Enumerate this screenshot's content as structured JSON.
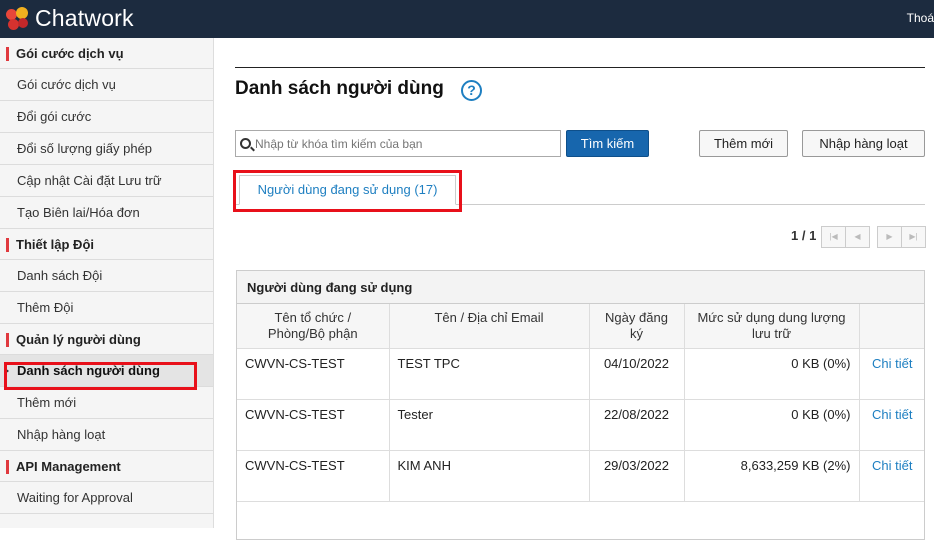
{
  "header": {
    "app_name": "Chatwork",
    "logout_label": "Thoá"
  },
  "sidebar": {
    "sections": [
      {
        "title": "Gói cước dịch vụ",
        "items": [
          "Gói cước dịch vụ",
          "Đổi gói cước",
          "Đổi số lượng giấy phép",
          "Cập nhật Cài đặt Lưu trữ",
          "Tạo Biên lai/Hóa đơn"
        ]
      },
      {
        "title": "Thiết lập Đội",
        "items": [
          "Danh sách Đội",
          "Thêm Đội"
        ]
      },
      {
        "title": "Quản lý người dùng",
        "items": [
          "Danh sách người dùng",
          "Thêm mới",
          "Nhập hàng loạt"
        ]
      },
      {
        "title": "API Management",
        "items": [
          "Waiting for Approval"
        ]
      }
    ],
    "active_item": "Danh sách người dùng"
  },
  "main": {
    "page_title": "Danh sách người dùng",
    "help_icon": "question-circle-icon",
    "search": {
      "placeholder": "Nhập từ khóa tìm kiếm của bạn",
      "value": "",
      "button": "Tìm kiếm"
    },
    "actions": {
      "add_new": "Thêm mới",
      "bulk_import": "Nhập hàng loạt"
    },
    "tab": "Người dùng đang sử dụng (17)",
    "pager": {
      "text": "1 / 1"
    },
    "table": {
      "caption": "Người dùng đang sử dụng",
      "columns": [
        "Tên tổ chức / Phòng/Bộ phận",
        "Tên / Địa chỉ Email",
        "Ngày đăng ký",
        "Mức sử dụng dung lượng lưu trữ",
        ""
      ],
      "rows": [
        {
          "org": "CWVN-CS-TEST",
          "name": "TEST TPC",
          "email": "",
          "date": "04/10/2022",
          "usage": "0 KB (0%)",
          "detail": "Chi tiết"
        },
        {
          "org": "CWVN-CS-TEST",
          "name": "Tester",
          "email": "",
          "date": "22/08/2022",
          "usage": "0 KB (0%)",
          "detail": "Chi tiết"
        },
        {
          "org": "CWVN-CS-TEST",
          "name": "KIM ANH",
          "email": "",
          "date": "29/03/2022",
          "usage": "8,633,259 KB (2%)",
          "detail": "Chi tiết"
        }
      ]
    }
  },
  "colors": {
    "topbar": "#1c2b3f",
    "accent": "#1766ad",
    "highlight": "#e8101a",
    "section_marker": "#e0393e"
  }
}
